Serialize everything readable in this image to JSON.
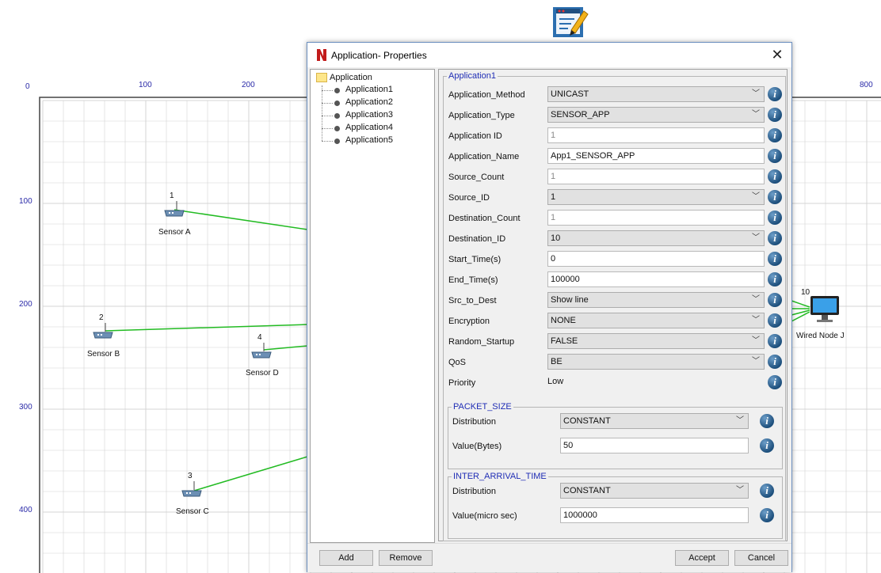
{
  "canvas": {
    "x_ticks": [
      "0",
      "100",
      "200",
      "800"
    ],
    "y_ticks": [
      "100",
      "200",
      "300",
      "400"
    ],
    "nodes": [
      {
        "id": "1",
        "name": "Sensor A"
      },
      {
        "id": "2",
        "name": "Sensor B"
      },
      {
        "id": "3",
        "name": "Sensor C"
      },
      {
        "id": "4",
        "name": "Sensor D"
      },
      {
        "id": "10",
        "name": "Wired Node J"
      }
    ],
    "link_color": "#22bb22",
    "grid_color": "#d4d4d4"
  },
  "toolbar": {
    "icon": "application-edit-icon"
  },
  "dialog": {
    "title": "Application- Properties",
    "close_icon": "close-icon",
    "tree": {
      "root": "Application",
      "items": [
        "Application1",
        "Application2",
        "Application3",
        "Application4",
        "Application5"
      ]
    },
    "group_title": "Application1",
    "fields": [
      {
        "label": "Application_Method",
        "value": "UNICAST",
        "kind": "select"
      },
      {
        "label": "Application_Type",
        "value": "SENSOR_APP",
        "kind": "select"
      },
      {
        "label": "Application ID",
        "value": "1",
        "kind": "disabled"
      },
      {
        "label": "Application_Name",
        "value": "App1_SENSOR_APP",
        "kind": "text"
      },
      {
        "label": "Source_Count",
        "value": "1",
        "kind": "disabled"
      },
      {
        "label": "Source_ID",
        "value": "1",
        "kind": "select"
      },
      {
        "label": "Destination_Count",
        "value": "1",
        "kind": "disabled"
      },
      {
        "label": "Destination_ID",
        "value": "10",
        "kind": "select"
      },
      {
        "label": "Start_Time(s)",
        "value": "0",
        "kind": "text"
      },
      {
        "label": "End_Time(s)",
        "value": "100000",
        "kind": "text"
      },
      {
        "label": "Src_to_Dest",
        "value": "Show line",
        "kind": "select"
      },
      {
        "label": "Encryption",
        "value": "NONE",
        "kind": "select"
      },
      {
        "label": "Random_Startup",
        "value": "FALSE",
        "kind": "select"
      },
      {
        "label": "QoS",
        "value": "BE",
        "kind": "select"
      },
      {
        "label": "Priority",
        "value": "Low",
        "kind": "plain"
      }
    ],
    "packet_size": {
      "title": "PACKET_SIZE",
      "distribution_label": "Distribution",
      "distribution_value": "CONSTANT",
      "value_label": "Value(Bytes)",
      "value": "50"
    },
    "inter_arrival": {
      "title": "INTER_ARRIVAL_TIME",
      "distribution_label": "Distribution",
      "distribution_value": "CONSTANT",
      "value_label": "Value(micro sec)",
      "value": "1000000"
    },
    "buttons": {
      "add": "Add",
      "remove": "Remove",
      "accept": "Accept",
      "cancel": "Cancel"
    },
    "info_glyph": "i"
  }
}
